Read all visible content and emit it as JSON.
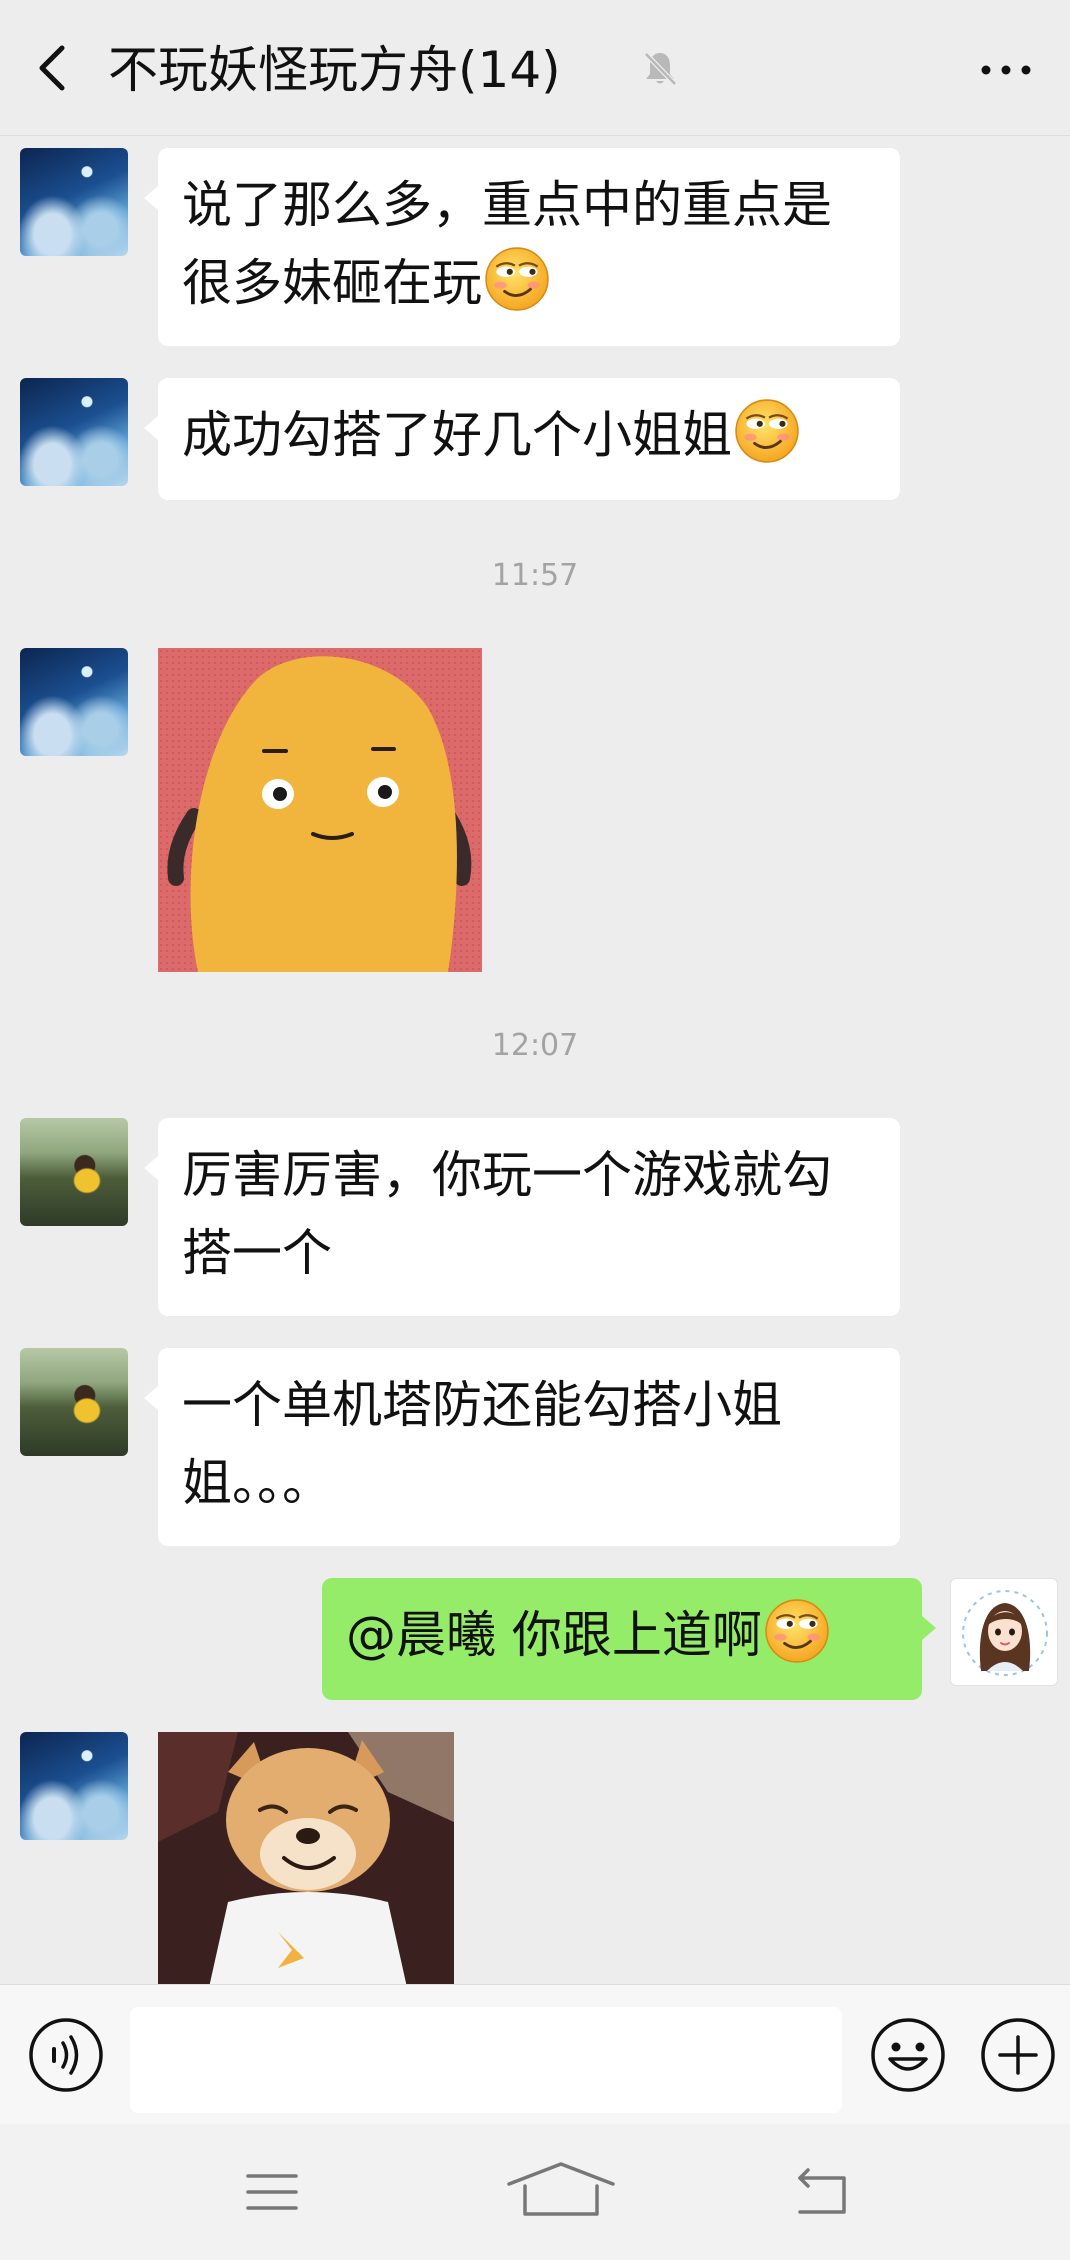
{
  "header": {
    "title": "不玩妖怪玩方舟(14)",
    "back_icon": "chevron-left-icon",
    "mute_icon": "bell-muted-icon",
    "more_icon": "more-dots-icon"
  },
  "messages": [
    {
      "sender": "other",
      "avatar": "night-sky",
      "text": "说了那么多，重点中的重点是很多妹砸在玩",
      "emoji": "smirk"
    },
    {
      "sender": "other",
      "avatar": "night-sky",
      "text": "成功勾搭了好几个小姐姐",
      "emoji": "smirk"
    },
    {
      "type": "time",
      "text": "11:57"
    },
    {
      "sender": "other",
      "avatar": "night-sky",
      "sticker": "potato"
    },
    {
      "type": "time",
      "text": "12:07"
    },
    {
      "sender": "other",
      "avatar": "boy-by-lake",
      "text": "厉害厉害，你玩一个游戏就勾搭一个"
    },
    {
      "sender": "other",
      "avatar": "boy-by-lake",
      "text": "一个单机塔防还能勾搭小姐姐。。。"
    },
    {
      "sender": "me",
      "avatar": "girl-cartoon",
      "text": "@晨曦  你跟上道啊",
      "emoji": "smirk"
    },
    {
      "sender": "other",
      "avatar": "night-sky",
      "sticker": "shiba-dog"
    }
  ],
  "input_bar": {
    "placeholder": "",
    "voice_icon": "voice-icon",
    "emoji_icon": "emoji-icon",
    "plus_icon": "plus-icon"
  },
  "nav_bar": {
    "menu_icon": "menu-icon",
    "home_icon": "home-icon",
    "back_icon": "back-arrow-icon"
  },
  "colors": {
    "background": "#ededed",
    "bubble_other": "#ffffff",
    "bubble_me": "#95ec69",
    "timestamp": "#a3a3a3",
    "potato_bg": "#dd6a6a",
    "potato_body": "#f1b53e"
  }
}
